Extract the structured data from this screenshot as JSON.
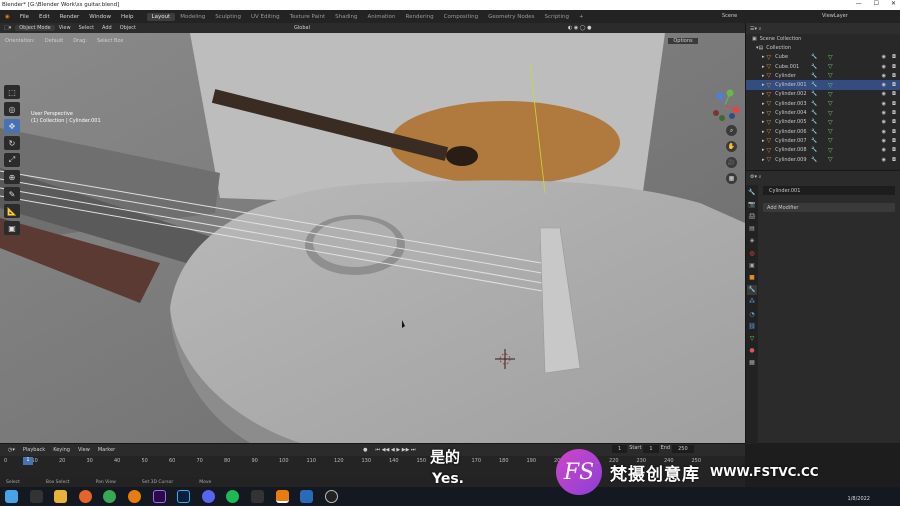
{
  "titlebar": {
    "title": "Blender* [G:\\Blender Work\\ss guitar.blend]",
    "minimize": "—",
    "maximize": "☐",
    "close": "✕"
  },
  "menu": [
    "File",
    "Edit",
    "Render",
    "Window",
    "Help"
  ],
  "workspaces": [
    "Layout",
    "Modeling",
    "Sculpting",
    "UV Editing",
    "Texture Paint",
    "Shading",
    "Animation",
    "Rendering",
    "Compositing",
    "Geometry Nodes",
    "Scripting",
    "+"
  ],
  "active_workspace": "Layout",
  "scene": {
    "label": "Scene",
    "view_layer": "ViewLayer"
  },
  "viewport_header": {
    "mode": "Object Mode",
    "items": [
      "View",
      "Select",
      "Add",
      "Object"
    ],
    "transform": "Global",
    "options": "Options"
  },
  "option_bar": {
    "orientation_label": "Orientation:",
    "orientation_value": "Default",
    "drag_label": "Drag:",
    "drag_value": "Select Box"
  },
  "viewport_info": {
    "view": "User Perspective",
    "collection": "(1) Collection | Cylinder.001"
  },
  "gizmo": {
    "x": "X",
    "y": "Y",
    "z": "Z"
  },
  "outliner": {
    "header": "Scene Collection",
    "collection": "Collection",
    "items": [
      {
        "name": "Cube",
        "selected": false
      },
      {
        "name": "Cube.001",
        "selected": false
      },
      {
        "name": "Cylinder",
        "selected": false
      },
      {
        "name": "Cylinder.001",
        "selected": true
      },
      {
        "name": "Cylinder.002",
        "selected": false
      },
      {
        "name": "Cylinder.003",
        "selected": false
      },
      {
        "name": "Cylinder.004",
        "selected": false
      },
      {
        "name": "Cylinder.005",
        "selected": false
      },
      {
        "name": "Cylinder.006",
        "selected": false
      },
      {
        "name": "Cylinder.007",
        "selected": false
      },
      {
        "name": "Cylinder.008",
        "selected": false
      },
      {
        "name": "Cylinder.009",
        "selected": false
      }
    ]
  },
  "properties": {
    "object_name": "Cylinder.001",
    "add_modifier": "Add Modifier"
  },
  "timeline": {
    "menus": [
      "Playback",
      "Keying",
      "View",
      "Marker"
    ],
    "current_frame": "1",
    "start_label": "Start",
    "start": "1",
    "end_label": "End",
    "end": "250",
    "ruler": [
      "0",
      "10",
      "20",
      "30",
      "40",
      "50",
      "60",
      "70",
      "80",
      "90",
      "100",
      "110",
      "120",
      "130",
      "140",
      "150",
      "160",
      "170",
      "180",
      "190",
      "200",
      "210",
      "220",
      "230",
      "240",
      "250"
    ]
  },
  "statusbar": [
    "Select",
    "Box Select",
    "Pan View",
    "Set 3D Cursor",
    "Move"
  ],
  "subtitle": {
    "cn": "是的",
    "en": "Yes."
  },
  "watermark": {
    "logo": "FS",
    "cn": "梵摄创意库",
    "en": "WWW.FSTVC.CC"
  },
  "clock": "1/8/2022",
  "colors": {
    "accent": "#4772b3",
    "selection": "#334d80",
    "viewport": "#7a7a7a",
    "mesh_orange": "#e08a2a"
  }
}
